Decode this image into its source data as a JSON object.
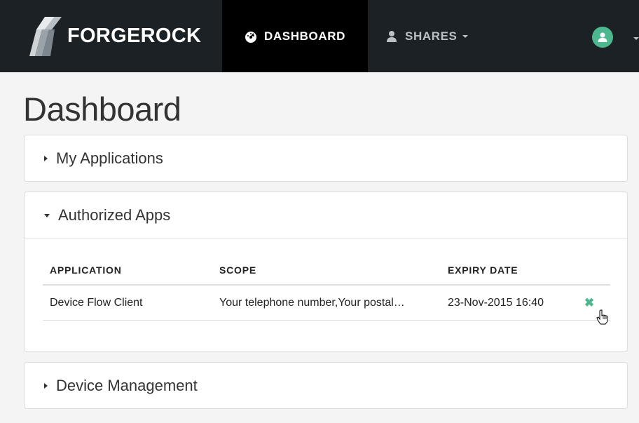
{
  "navbar": {
    "brand": "FORGEROCK",
    "dashboard_label": "DASHBOARD",
    "shares_label": "SHARES",
    "dashboard_icon": "tachometer-icon",
    "shares_icon": "user-icon",
    "user_icon": "user-avatar-icon",
    "accent": "#4db88f"
  },
  "page": {
    "title": "Dashboard"
  },
  "panels": {
    "my_applications": {
      "title": "My Applications",
      "expanded": false
    },
    "authorized_apps": {
      "title": "Authorized Apps",
      "expanded": true,
      "columns": [
        "APPLICATION",
        "SCOPE",
        "EXPIRY DATE"
      ],
      "rows": [
        {
          "application": "Device Flow Client",
          "scope": "Your telephone number,Your postal…",
          "expiry": "23-Nov-2015 16:40",
          "action_icon": "remove-icon"
        }
      ]
    },
    "device_management": {
      "title": "Device Management",
      "expanded": false
    }
  }
}
